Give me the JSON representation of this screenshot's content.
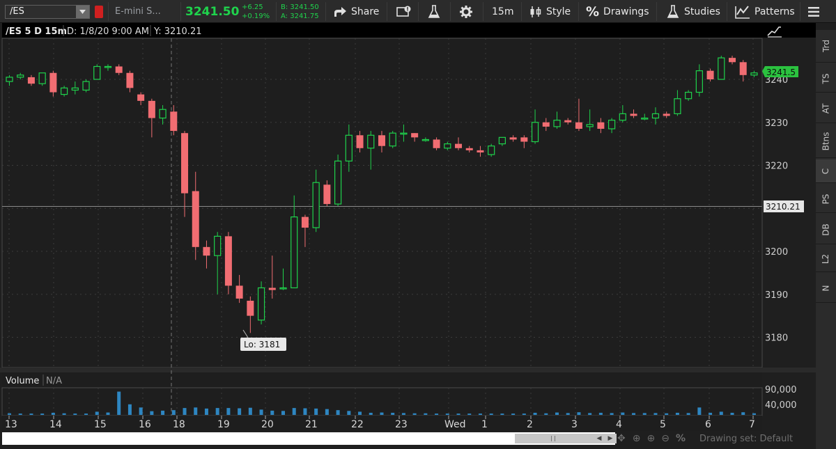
{
  "toolbar": {
    "symbol": "/ES",
    "description": "E-mini S...",
    "last_price": "3241.50",
    "change": "+6.25",
    "change_pct": "+0.19%",
    "bid": "B: 3241.50",
    "ask": "A: 3241.75",
    "share_label": "Share",
    "timeframe_label": "15m",
    "style_label": "Style",
    "drawings_label": "Drawings",
    "studies_label": "Studies",
    "patterns_label": "Patterns"
  },
  "chart_header": {
    "symbol_period": "/ES 5 D 15m",
    "date_label": "D: 1/8/20 9:00 AM",
    "value_label": "Y: 3210.21"
  },
  "volume_header": {
    "label": "Volume",
    "value": "N/A"
  },
  "right_tabs": [
    "Trd",
    "TS",
    "AT",
    "Btns",
    "C",
    "PS",
    "DB",
    "L2",
    "N"
  ],
  "bottom_bar": {
    "drawing_set": "Drawing set: Default"
  },
  "colors": {
    "up": "#1fd34c",
    "down": "#f16d72",
    "volume": "#2e86c1",
    "price_tag": "#2bc23f",
    "background": "#1e1e1e"
  },
  "chart_data": {
    "type": "candlestick",
    "ylim": [
      3172,
      3250
    ],
    "yticks": [
      3180,
      3190,
      3200,
      3210,
      3220,
      3230,
      3240
    ],
    "current_price_tag": "3241.5",
    "crosshair_value_tag": "3210.21",
    "low_annotation": "Lo: 3181",
    "xtick_labels": [
      "13",
      "14",
      "15",
      "16",
      "18",
      "19",
      "20",
      "21",
      "22",
      "23",
      "Wed",
      "1",
      "2",
      "3",
      "4",
      "5",
      "6",
      "7"
    ],
    "volume_ticks": [
      "90,000",
      "40,000"
    ],
    "candles": [
      [
        3239.5,
        3241,
        3238.5,
        3240.5
      ],
      [
        3240.5,
        3241.5,
        3240,
        3241
      ],
      [
        3240.5,
        3241,
        3238.5,
        3239
      ],
      [
        3239,
        3241.5,
        3238.5,
        3241.5
      ],
      [
        3241.5,
        3242,
        3236,
        3237
      ],
      [
        3236.5,
        3238.5,
        3236,
        3238
      ],
      [
        3237.5,
        3239.5,
        3236.5,
        3238
      ],
      [
        3237.5,
        3240,
        3237,
        3239.5
      ],
      [
        3240,
        3243.5,
        3240,
        3243
      ],
      [
        3243,
        3243.5,
        3242,
        3243
      ],
      [
        3243,
        3243.5,
        3241,
        3241.5
      ],
      [
        3241.5,
        3242,
        3237,
        3238
      ],
      [
        3236.5,
        3237,
        3234,
        3235
      ],
      [
        3235,
        3235.5,
        3226.5,
        3231
      ],
      [
        3231,
        3234,
        3229.5,
        3233
      ],
      [
        3232.5,
        3234,
        3227,
        3228
      ],
      [
        3227.5,
        3228,
        3208,
        3213.5
      ],
      [
        3214,
        3218.5,
        3198,
        3201
      ],
      [
        3201,
        3202.5,
        3196,
        3199
      ],
      [
        3199,
        3204.5,
        3190,
        3203.5
      ],
      [
        3203.5,
        3204.5,
        3190,
        3192
      ],
      [
        3192,
        3194.5,
        3188,
        3189
      ],
      [
        3188.5,
        3189.5,
        3181,
        3185
      ],
      [
        3184,
        3193,
        3183,
        3191.5
      ],
      [
        3191.5,
        3199,
        3189,
        3191
      ],
      [
        3191.5,
        3196,
        3191,
        3191.5
      ],
      [
        3191.5,
        3213,
        3191.5,
        3208
      ],
      [
        3208,
        3208.5,
        3201,
        3205.5
      ],
      [
        3205.5,
        3219,
        3204.5,
        3216
      ],
      [
        3215.5,
        3216.5,
        3210.5,
        3211
      ],
      [
        3211,
        3222.5,
        3210.5,
        3221
      ],
      [
        3221,
        3229.5,
        3218.5,
        3227
      ],
      [
        3227,
        3228,
        3223,
        3224
      ],
      [
        3224,
        3228,
        3219,
        3227
      ],
      [
        3227,
        3228,
        3223,
        3224.5
      ],
      [
        3224.5,
        3228,
        3224,
        3227.5
      ],
      [
        3227.5,
        3229.5,
        3225.5,
        3227.5
      ],
      [
        3227.5,
        3227.5,
        3225.5,
        3226.5
      ],
      [
        3226,
        3226.5,
        3225.5,
        3226
      ],
      [
        3226,
        3226.5,
        3223.5,
        3224
      ],
      [
        3224,
        3225.5,
        3223.5,
        3225
      ],
      [
        3225,
        3226.5,
        3223.5,
        3224
      ],
      [
        3224,
        3224.5,
        3223,
        3223.5
      ],
      [
        3223.5,
        3224.5,
        3222,
        3223
      ],
      [
        3222.5,
        3225,
        3222,
        3224.5
      ],
      [
        3225,
        3226.5,
        3224.5,
        3226.5
      ],
      [
        3226.5,
        3227,
        3225.5,
        3226
      ],
      [
        3226.5,
        3227,
        3224,
        3225.5
      ],
      [
        3225.5,
        3233,
        3225,
        3230
      ],
      [
        3230,
        3231,
        3228,
        3229
      ],
      [
        3229,
        3232.5,
        3228.5,
        3230.5
      ],
      [
        3230.5,
        3231,
        3229.5,
        3230
      ],
      [
        3230,
        3235.5,
        3228,
        3228.5
      ],
      [
        3229,
        3233,
        3228,
        3229.5
      ],
      [
        3230,
        3231,
        3227.5,
        3228.5
      ],
      [
        3228.5,
        3231,
        3227.5,
        3230.5
      ],
      [
        3230.5,
        3234,
        3230,
        3232
      ],
      [
        3232,
        3233,
        3231,
        3231.5
      ],
      [
        3231,
        3232,
        3230.5,
        3231
      ],
      [
        3231,
        3233.5,
        3229.5,
        3232
      ],
      [
        3232,
        3232.5,
        3231,
        3231.5
      ],
      [
        3232,
        3237.5,
        3231.5,
        3235.5
      ],
      [
        3235.5,
        3237.5,
        3235,
        3237
      ],
      [
        3237,
        3243.5,
        3236,
        3242
      ],
      [
        3242,
        3242.5,
        3239.5,
        3240
      ],
      [
        3240,
        3245.5,
        3240,
        3245
      ],
      [
        3245,
        3245.5,
        3243.5,
        3244
      ],
      [
        3244,
        3244.5,
        3239.5,
        3241
      ],
      [
        3241,
        3242,
        3240.5,
        3241.5
      ]
    ],
    "volumes": [
      6,
      5,
      5,
      5,
      8,
      6,
      5,
      5,
      12,
      9,
      88,
      40,
      28,
      14,
      16,
      18,
      26,
      28,
      24,
      26,
      26,
      25,
      27,
      20,
      16,
      15,
      26,
      25,
      24,
      22,
      18,
      15,
      12,
      8,
      9,
      8,
      7,
      6,
      6,
      5,
      5,
      5,
      5,
      5,
      5,
      5,
      5,
      5,
      8,
      6,
      9,
      7,
      10,
      7,
      8,
      7,
      9,
      7,
      7,
      7,
      6,
      8,
      7,
      28,
      8,
      12,
      8,
      10,
      6
    ]
  }
}
